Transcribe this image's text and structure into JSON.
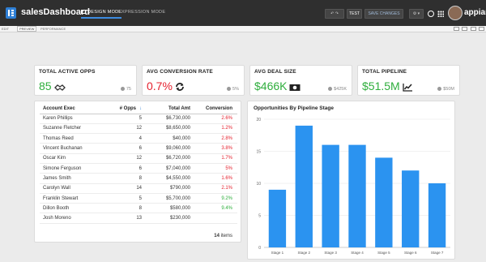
{
  "app": {
    "title": "salesDashboard",
    "modes": [
      "DESIGN MODE",
      "EXPRESSION MODE"
    ],
    "brand": "appian"
  },
  "toolbar": {
    "undo_redo": "↶ ↷",
    "test_label": "TEST",
    "save_label": "SAVE CHANGES",
    "gear_label": "⚙ ▾"
  },
  "subtabs": [
    "EDIT",
    "PREVIEW",
    "PERFORMANCE"
  ],
  "kpis": [
    {
      "label": "TOTAL ACTIVE OPPS",
      "value": "85",
      "compare": "75",
      "color": "#2fae3d",
      "icon": "handshake-icon"
    },
    {
      "label": "AVG CONVERSION RATE",
      "value": "0.7%",
      "compare": "5%",
      "color": "#e5212e",
      "icon": "refresh-icon"
    },
    {
      "label": "AVG DEAL SIZE",
      "value": "$466K",
      "compare": "$425K",
      "color": "#2fae3d",
      "icon": "money-icon"
    },
    {
      "label": "TOTAL PIPELINE",
      "value": "$51.5M",
      "compare": "$50M",
      "color": "#2fae3d",
      "icon": "line-chart-icon"
    }
  ],
  "table": {
    "headers": [
      "Account Exec",
      "# Opps",
      "Total Amt",
      "Conversion"
    ],
    "rows": [
      {
        "name": "Karen Phillips",
        "opps": "5",
        "amt": "$6,730,000",
        "conv": "2.6%",
        "conv_color": "#e5212e"
      },
      {
        "name": "Suzanne Fletcher",
        "opps": "12",
        "amt": "$8,650,000",
        "conv": "1.2%",
        "conv_color": "#e5212e"
      },
      {
        "name": "Thomas Reed",
        "opps": "4",
        "amt": "$40,000",
        "conv": "2.8%",
        "conv_color": "#e5212e"
      },
      {
        "name": "Vincent Buchanan",
        "opps": "6",
        "amt": "$9,060,000",
        "conv": "3.8%",
        "conv_color": "#e5212e"
      },
      {
        "name": "Oscar Kim",
        "opps": "12",
        "amt": "$6,720,000",
        "conv": "1.7%",
        "conv_color": "#e5212e"
      },
      {
        "name": "Simone Ferguson",
        "opps": "6",
        "amt": "$7,040,000",
        "conv": "5%",
        "conv_color": "#e5212e"
      },
      {
        "name": "James Smith",
        "opps": "8",
        "amt": "$4,550,000",
        "conv": "1.6%",
        "conv_color": "#e5212e"
      },
      {
        "name": "Carolyn Wall",
        "opps": "14",
        "amt": "$790,000",
        "conv": "2.1%",
        "conv_color": "#e5212e"
      },
      {
        "name": "Franklin Stewart",
        "opps": "5",
        "amt": "$5,700,000",
        "conv": "9.2%",
        "conv_color": "#2fae3d"
      },
      {
        "name": "Dillon Booth",
        "opps": "8",
        "amt": "$580,000",
        "conv": "9.4%",
        "conv_color": "#2fae3d"
      },
      {
        "name": "Josh Moreno",
        "opps": "13",
        "amt": "$230,000",
        "conv": "",
        "conv_color": "#2fae3d"
      }
    ],
    "footer_count": "14",
    "footer_suffix": "items"
  },
  "chart_data": {
    "type": "bar",
    "title": "Opportunities By Pipeline Stage",
    "categories": [
      "Stage 1",
      "Stage 2",
      "Stage 3",
      "Stage 4",
      "Stage 5",
      "Stage 6",
      "Stage 7"
    ],
    "values": [
      9,
      19,
      16,
      16,
      14,
      12,
      10
    ],
    "ylim": [
      0,
      20
    ],
    "yticks": [
      0,
      5,
      10,
      15,
      20
    ],
    "color": "#2b93f0",
    "grid": true
  }
}
